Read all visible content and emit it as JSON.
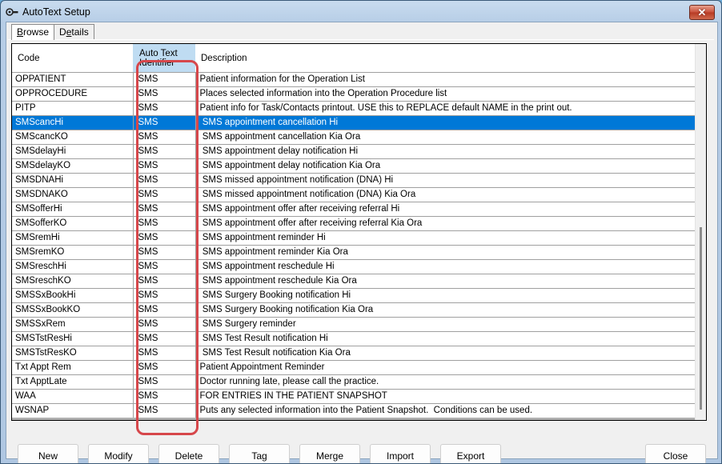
{
  "window": {
    "title": "AutoText Setup",
    "icon": "key-icon",
    "close_glyph": "✕"
  },
  "tabs": [
    {
      "label_underline": "B",
      "label_rest": "rowse",
      "label": "Browse",
      "active": true
    },
    {
      "label_pre": "D",
      "label_underline": "e",
      "label_rest": "tails",
      "label": "Details",
      "active": false
    }
  ],
  "grid": {
    "columns": [
      "Code",
      "Auto Text\nIdentifier",
      "Description"
    ],
    "column_id_line1": "Auto Text",
    "column_id_line2": "Identifier",
    "selected_row": 3,
    "rows": [
      {
        "code": "OPPATIENT",
        "id": "SMS",
        "desc": "Patient information for the Operation List"
      },
      {
        "code": "OPPROCEDURE",
        "id": "SMS",
        "desc": "Places selected information into the Operation Procedure list"
      },
      {
        "code": "PITP",
        "id": "SMS",
        "desc": "Patient info for Task/Contacts printout. USE this to REPLACE default NAME in the print out."
      },
      {
        "code": "SMScancHi",
        "id": "SMS",
        "desc": " SMS appointment cancellation Hi"
      },
      {
        "code": "SMScancKO",
        "id": "SMS",
        "desc": " SMS appointment cancellation Kia Ora"
      },
      {
        "code": "SMSdelayHi",
        "id": "SMS",
        "desc": " SMS appointment delay notification Hi"
      },
      {
        "code": "SMSdelayKO",
        "id": "SMS",
        "desc": " SMS appointment delay notification Kia Ora"
      },
      {
        "code": "SMSDNAHi",
        "id": "SMS",
        "desc": " SMS missed appointment notification (DNA) Hi"
      },
      {
        "code": "SMSDNAKO",
        "id": "SMS",
        "desc": " SMS missed appointment notification (DNA) Kia Ora"
      },
      {
        "code": "SMSofferHi",
        "id": "SMS",
        "desc": " SMS appointment offer after receiving referral Hi"
      },
      {
        "code": "SMSofferKO",
        "id": "SMS",
        "desc": " SMS appointment offer after receiving referral Kia Ora"
      },
      {
        "code": "SMSremHi",
        "id": "SMS",
        "desc": " SMS appointment reminder Hi"
      },
      {
        "code": "SMSremKO",
        "id": "SMS",
        "desc": " SMS appointment reminder Kia Ora"
      },
      {
        "code": "SMSreschHi",
        "id": "SMS",
        "desc": " SMS appointment reschedule Hi"
      },
      {
        "code": "SMSreschKO",
        "id": "SMS",
        "desc": " SMS appointment reschedule Kia Ora"
      },
      {
        "code": "SMSSxBookHi",
        "id": "SMS",
        "desc": " SMS Surgery Booking notification Hi"
      },
      {
        "code": "SMSSxBookKO",
        "id": "SMS",
        "desc": " SMS Surgery Booking notification Kia Ora"
      },
      {
        "code": "SMSSxRem",
        "id": "SMS",
        "desc": " SMS Surgery reminder"
      },
      {
        "code": "SMSTstResHi",
        "id": "SMS",
        "desc": " SMS Test Result notification Hi"
      },
      {
        "code": "SMSTstResKO",
        "id": "SMS",
        "desc": " SMS Test Result notification Kia Ora"
      },
      {
        "code": "Txt Appt Rem",
        "id": "SMS",
        "desc": "Patient Appointment Reminder"
      },
      {
        "code": "Txt ApptLate",
        "id": "SMS",
        "desc": "Doctor running late, please call the practice."
      },
      {
        "code": "WAA",
        "id": "SMS",
        "desc": "FOR ENTRIES IN THE PATIENT SNAPSHOT"
      },
      {
        "code": "WSNAP",
        "id": "SMS",
        "desc": "Puts any selected information into the Patient Snapshot.  Conditions can be used."
      }
    ]
  },
  "buttons": {
    "new": "New",
    "modify": "Modify",
    "delete": "Delete",
    "tag": "Tag",
    "merge": "Merge",
    "import": "Import",
    "export": "Export",
    "close": "Close"
  },
  "colors": {
    "selection": "#0078d7",
    "highlight_box": "#d6474b",
    "header_highlight": "#bfdcf2"
  }
}
